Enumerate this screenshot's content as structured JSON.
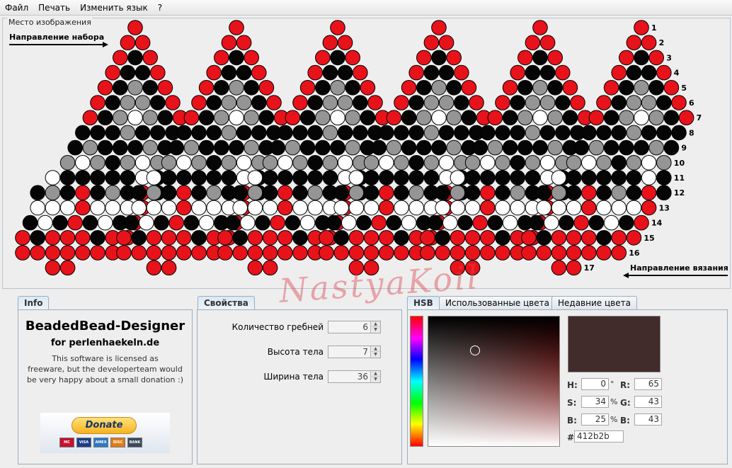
{
  "menu": [
    "Файл",
    "Печать",
    "Изменить язык",
    "?"
  ],
  "canvas": {
    "title": "Место изображения",
    "set_direction": "Направление набора",
    "knit_direction": "Направление вязания",
    "watermark": "NastyaKoil",
    "row_numbers": [
      "1",
      "2",
      "3",
      "4",
      "5",
      "6",
      "7",
      "8",
      "9",
      "10",
      "11",
      "12",
      "13",
      "14",
      "15",
      "16",
      "17"
    ]
  },
  "bead_colors": {
    "R": "#e8121a",
    "K": "#050505",
    "G": "#959595",
    "W": "#ffffff"
  },
  "bead_rows": [
    "R",
    "RR",
    "RKR",
    "RKKR",
    "RKGKR",
    "RKGGKR",
    "RKGWGKR",
    "KKKGKKK",
    "KGKKKGK",
    "GWGKGWG",
    "WKKKKKWK",
    "KGKRKGKRK",
    "WWWRWWWR",
    "KWKRKWKR",
    "RKRRRKRR",
    "RRRRRRR",
    "RR"
  ],
  "tabs": {
    "info": "Info",
    "properties": "Свойства",
    "color_tabs": [
      "HSB",
      "Использованные цвета",
      "Недавние цвета"
    ]
  },
  "info": {
    "app_name": "BeadedBead-Designer",
    "site": "for perlenhaekeln.de",
    "license_line1": "This software is licensed as",
    "license_line2": "freeware, but the developerteam would",
    "license_line3": "be very happy about a small donation :)",
    "donate": "Donate",
    "cards": [
      "MC",
      "VISA",
      "AMEX",
      "DISC",
      "BANK"
    ]
  },
  "properties": {
    "fields": [
      {
        "label": "Количество гребней",
        "value": "6"
      },
      {
        "label": "Высота тела",
        "value": "7"
      },
      {
        "label": "Ширина тела",
        "value": "36"
      }
    ]
  },
  "color": {
    "swatch": "#412b2b",
    "h_label": "H:",
    "h": "0",
    "h_unit": "°",
    "s_label": "S:",
    "s": "34",
    "s_unit": "%",
    "b_label": "B:",
    "b": "25",
    "b_unit": "%",
    "r_label": "R:",
    "r": "65",
    "g_label": "G:",
    "g": "43",
    "bb_label": "B:",
    "bb": "43",
    "hex_label": "#",
    "hex": "412b2b"
  }
}
